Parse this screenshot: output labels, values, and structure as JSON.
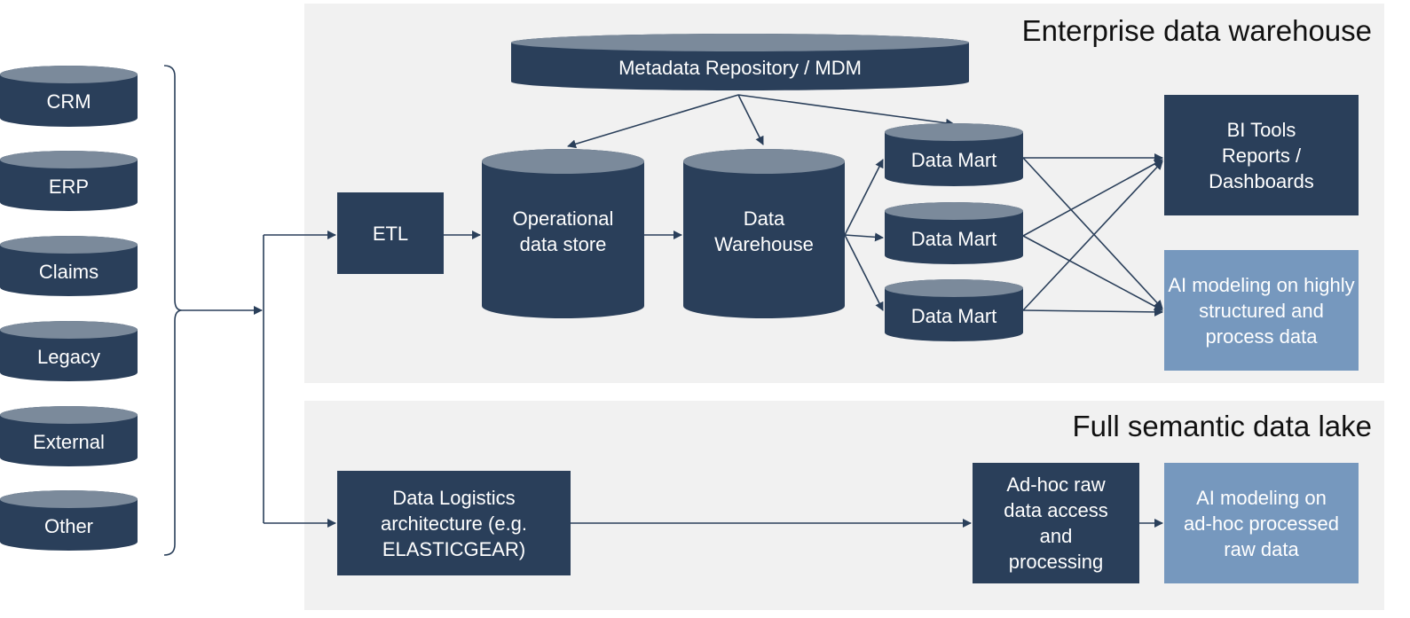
{
  "colors": {
    "dark": "#2a3f5a",
    "cap": "#7b8a9b",
    "light": "#7698be",
    "panel": "#f1f1f1",
    "line": "#2a3f5a"
  },
  "sources": [
    "CRM",
    "ERP",
    "Claims",
    "Legacy",
    "External",
    "Other"
  ],
  "edw": {
    "title": "Enterprise data warehouse",
    "metadata": "Metadata Repository / MDM",
    "etl": "ETL",
    "ods": "Operational data store",
    "dw": "Data Warehouse",
    "marts": [
      "Data Mart",
      "Data Mart",
      "Data Mart"
    ],
    "bi": "BI Tools Reports / Dashboards",
    "ai": "AI modeling on highly structured and process data"
  },
  "lake": {
    "title": "Full semantic data lake",
    "logistics": "Data Logistics architecture (e.g. ELASTICGEAR)",
    "adhoc": "Ad-hoc raw data access and processing",
    "ai": "AI modeling on ad-hoc processed raw data"
  }
}
